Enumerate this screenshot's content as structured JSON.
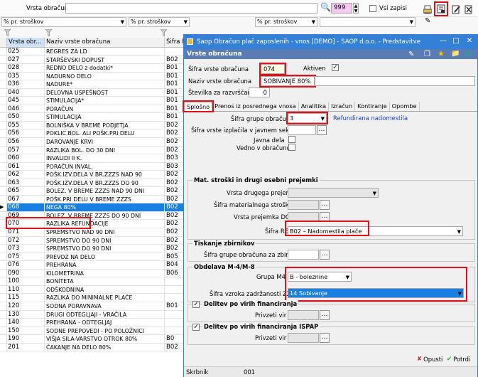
{
  "toolbar": {
    "vrsta_label": "Vrsta obračuna",
    "counter": "999",
    "vsi_zapisi": "Vsi zapisi"
  },
  "filters": {
    "f1": "% pr. stroškov",
    "f2": "% pr. stroškov",
    "f3": "% pr. stroškov"
  },
  "grid": {
    "headers": [
      "Vrsta obr...",
      "Naziv vrste obračuna",
      "Šifra R"
    ],
    "rows": [
      [
        "025",
        "REGRES ZA LD",
        ""
      ],
      [
        "027",
        "STARŠEVSKI DOPUST",
        "B02"
      ],
      [
        "028",
        "REDNO DELO z dodatki*",
        "B01"
      ],
      [
        "035",
        "NADURNO DELO",
        "B01"
      ],
      [
        "036",
        "NADURE*",
        "B01"
      ],
      [
        "040",
        "DELOVNA USPEŠNOST",
        "B01"
      ],
      [
        "045",
        "STIMULACIJA*",
        "B01"
      ],
      [
        "046",
        "PORAČUN",
        "B01"
      ],
      [
        "050",
        "STIMULACIJA",
        "B01"
      ],
      [
        "055",
        "BOLNIŠKA V BREME PODJETJA",
        "B02"
      ],
      [
        "056",
        "POKLIC.BOL. ALI POŠK.PRI DELU",
        "B02"
      ],
      [
        "056",
        "DAROVANJE KRVI",
        "B02"
      ],
      [
        "057",
        "RAZLIKA BOL. DO 30 DNI",
        "B02"
      ],
      [
        "060",
        "INVALIDI II K.",
        "B03"
      ],
      [
        "061",
        "PORAČUN INVAL.",
        "B03"
      ],
      [
        "062",
        "POŠK.IZV.DELA V BR.ZZZS NAD 90",
        "B02"
      ],
      [
        "063",
        "POŠK.IZV.DELA V BR.ZZZS DO 90",
        "B02"
      ],
      [
        "065",
        "BOLEZ. V BREME ZZZS NAD 90 DNI",
        "B02"
      ],
      [
        "067",
        "POŠK.PRI DELU V BREME ZZZS",
        "B02"
      ],
      [
        "068",
        "NEGA 80%",
        "B02"
      ],
      [
        "069",
        "BOLEZ. V BREME ZZZS DO 90 DNI",
        "B02"
      ],
      [
        "070",
        "RAZLIKA REFUNDACIJE",
        "B02"
      ],
      [
        "071",
        "SPREMSTVO NAD 90 DNI",
        "B02"
      ],
      [
        "072",
        "SPREMSTVO DO 90 DNI",
        "B02"
      ],
      [
        "073",
        "SPREMSTVO DO 90 DNI",
        "B02"
      ],
      [
        "075",
        "PREVOZ NA DELO",
        "B05"
      ],
      [
        "076",
        "PREHRANA",
        "B04"
      ],
      [
        "090",
        "KILOMETRINA",
        "B06"
      ],
      [
        "100",
        "BONITETA",
        ""
      ],
      [
        "110",
        "ODŠKODNINA",
        ""
      ],
      [
        "115",
        "RAZLIKA DO MINIMALNE PLAČE",
        ""
      ],
      [
        "120",
        "SODNA PORAVNAVA",
        "B01"
      ],
      [
        "130",
        "DRUGI ODTEGLJAJI - VRAČILA",
        ""
      ],
      [
        "140",
        "PREHRANA - ODTEGLJAJ",
        ""
      ],
      [
        "150",
        "SODNE PREPOVEDI - PO POLOŽNICI",
        ""
      ],
      [
        "190",
        "VIŠJA SILA-VARSTVO OTROK 80%",
        "B0"
      ],
      [
        "201",
        "ČAKANJE NA DELO 80%",
        "B02"
      ]
    ]
  },
  "dialog": {
    "title": "Saop Obračun plač zaposlenih - vnos [DEMO] - SAOP d.o.o. - Predstavitve",
    "section": "Vrste obračuna",
    "sifra_label": "Šifra vrste obračuna",
    "sifra_value": "074",
    "aktiven_label": "Aktiven",
    "naziv_label": "Naziv vrste obračuna",
    "naziv_value": "SOBIVANJE 80%",
    "stevilka_label": "Številka za razvrščanje",
    "stevilka_value": "0",
    "tabs": [
      "Splošno",
      "Prenos iz posrednega vnosa",
      "Analitika",
      "Izračun",
      "Kontiranje",
      "Opombe"
    ],
    "sifra_grupe_label": "Šifra grupe obračuna",
    "sifra_grupe_value": "3",
    "refund_text": "Refundirana nadomestila",
    "izplacila_label": "Šifra vrste izplačila v javnem sektorju",
    "javna_label": "Javna dela",
    "vedno_label": "Vedno v obračunu",
    "mat_title": "Mat. stroški in drugi osebni prejemki",
    "drugega_label": "Vrsta drugega prejemka",
    "materialnega_label": "Šifra materialnega stroška",
    "doh_label": "Vrsta prejemka DOH",
    "rek_label": "Šifra REK",
    "rek_value": "B02 – Nadomestila plače",
    "tisk_title": "Tiskanje zbirnikov",
    "zbirnik_label": "Šifra grupe obračuna za zbirnike",
    "m4_title": "Obdelava M-4/M-8",
    "grupa_m4_label": "Grupa M4",
    "grupa_m4_value": "B - boleznine",
    "vzrok_label": "Šifra vzroka zadržanosti ZZZS",
    "vzrok_value": "14 Sobivanje",
    "delitev_label": "Delitev po virih financiranja",
    "privzeti_label": "Privzeti vir",
    "delitev_ispap_label": "Delitev po virih financiranja ISPAP",
    "privzeti2_label": "Privzeti vir",
    "opusti": "Opusti",
    "potrdi": "Potrdi",
    "skrbnik_label": "Skrbnik",
    "skrbnik_value": "001"
  }
}
